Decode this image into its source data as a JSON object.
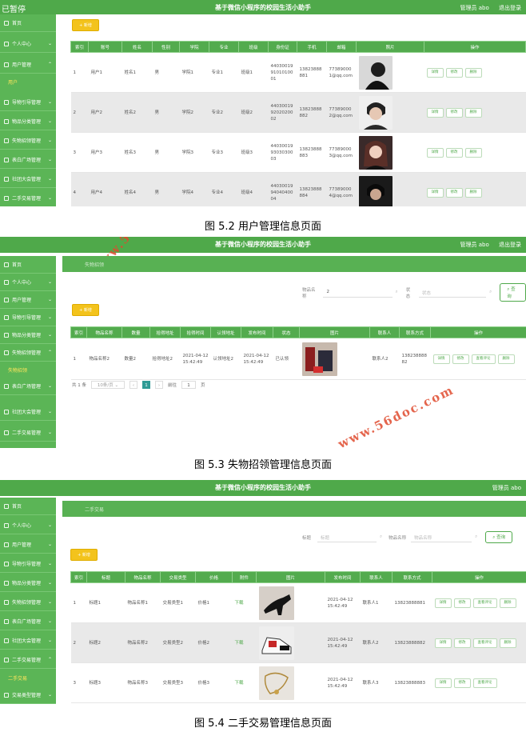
{
  "app_title": "基于微信小程序的校园生活小助手",
  "logo_text": "已暂停",
  "top_right": {
    "user": "管理员 abo",
    "logout": "退出登录"
  },
  "ops": {
    "detail": "详情",
    "edit": "修改",
    "delete": "删除",
    "comments": "查看评论"
  },
  "add_label": "+ 新增",
  "query_label": "查询",
  "watermark": "www.56doc.com",
  "sidebar": {
    "home": "首页",
    "personal": "个人中心",
    "user_mgmt": "用户管理",
    "user_sub": "用户",
    "guide": "导物引导管理",
    "goods_cat": "物品分类管理",
    "lost": "失物招领管理",
    "lost_sub": "失物招领",
    "square": "表白广场管理",
    "club": "社团大会管理",
    "second": "二手交易管理",
    "second_sub": "二手交易",
    "trade_type": "交易类型管理"
  },
  "screen1": {
    "caption": "图 5.2 用户管理信息页面",
    "columns": [
      "索引",
      "账号",
      "姓名",
      "性别",
      "学院",
      "专业",
      "班级",
      "身份证",
      "手机",
      "邮箱",
      "照片",
      "操作"
    ],
    "rows": [
      [
        "1",
        "用户1",
        "姓名1",
        "男",
        "学院1",
        "专业1",
        "班级1",
        "440300199101010001",
        "13823888881",
        "773890001@qq.com"
      ],
      [
        "2",
        "用户2",
        "姓名2",
        "男",
        "学院2",
        "专业2",
        "班级2",
        "440300199202020002",
        "13823888882",
        "773890002@qq.com"
      ],
      [
        "3",
        "用户3",
        "姓名3",
        "男",
        "学院3",
        "专业3",
        "班级3",
        "440300199303030003",
        "13823888883",
        "773890003@qq.com"
      ],
      [
        "4",
        "用户4",
        "姓名4",
        "男",
        "学院4",
        "专业4",
        "班级4",
        "440300199404040004",
        "13823888884",
        "773890004@qq.com"
      ]
    ]
  },
  "screen2": {
    "caption": "图 5.3 失物招领管理信息页面",
    "crumb": "失物招领",
    "filter1_label": "物品名称",
    "filter1_value": "2",
    "filter2_label": "状态",
    "filter2_placeholder": "状态",
    "columns": [
      "索引",
      "物品名称",
      "数量",
      "拾得地址",
      "拾得时间",
      "认领地址",
      "发布时间",
      "状态",
      "图片",
      "联系人",
      "联系方式",
      "操作"
    ],
    "rows": [
      [
        "1",
        "物品名称2",
        "数量2",
        "拾得地址2",
        "2021-04-12 15:42:49",
        "认领地址2",
        "2021-04-12 15:42:49",
        "已认领",
        "联系人2",
        "13823888882"
      ]
    ],
    "pager": {
      "total": "共 1 条",
      "size": "10条/页",
      "page": "1",
      "goto": "前往",
      "goto_val": "1",
      "unit": "页"
    }
  },
  "screen3": {
    "caption": "图 5.4 二手交易管理信息页面",
    "crumb": "二手交易",
    "filter1_label": "标题",
    "filter1_placeholder": "标题",
    "filter2_label": "物品名称",
    "filter2_placeholder": "物品名称",
    "columns": [
      "索引",
      "标题",
      "物品名称",
      "交易类型",
      "价格",
      "附件",
      "图片",
      "发布时间",
      "联系人",
      "联系方式",
      "操作"
    ],
    "download": "下载",
    "rows": [
      [
        "1",
        "标题1",
        "物品名称1",
        "交易类型1",
        "价格1",
        "2021-04-12 15:42:49",
        "联系人1",
        "13823888881"
      ],
      [
        "2",
        "标题2",
        "物品名称2",
        "交易类型2",
        "价格2",
        "2021-04-12 15:42:49",
        "联系人2",
        "13823888882"
      ],
      [
        "3",
        "标题3",
        "物品名称3",
        "交易类型3",
        "价格3",
        "2021-04-12 15:42:49",
        "联系人3",
        "13823888883"
      ]
    ]
  }
}
